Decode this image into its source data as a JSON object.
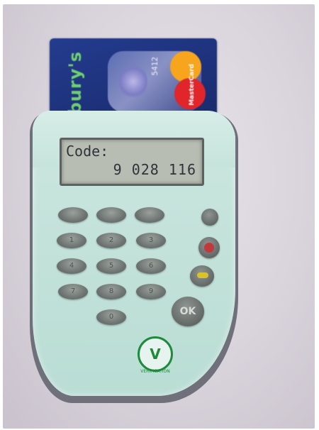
{
  "card": {
    "brand_text": "Sainsbury's",
    "card_network": "MasterCard",
    "hologram_digits": "5412"
  },
  "reader": {
    "lcd_line1": "Code:",
    "lcd_line2": "9 028 116",
    "keys": [
      "",
      "",
      "",
      "1",
      "2",
      "3",
      "4",
      "5",
      "6",
      "7",
      "8",
      "9",
      "0"
    ],
    "ok_label": "OK",
    "logo_mark": "V",
    "logo_text": "VERIFICATION"
  }
}
